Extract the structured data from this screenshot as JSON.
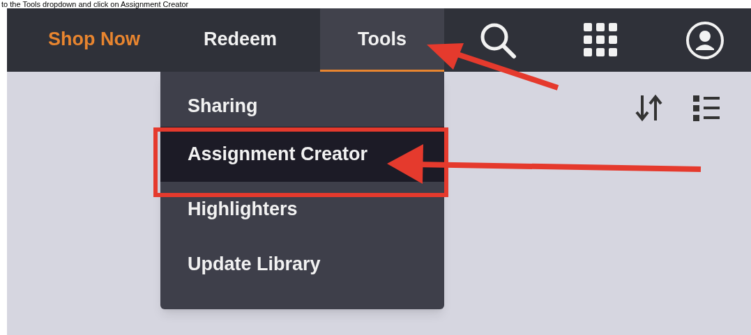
{
  "caption": "to the Tools dropdown and click on Assignment Creator",
  "nav": [
    {
      "label": "Shop Now",
      "kind": "promo",
      "selected": false
    },
    {
      "label": "Redeem",
      "kind": "link",
      "selected": false
    },
    {
      "label": "Tools",
      "kind": "link",
      "selected": true
    }
  ],
  "tools_menu": [
    {
      "label": "Sharing",
      "selected": false
    },
    {
      "label": "Assignment Creator",
      "selected": true
    },
    {
      "label": "Highlighters",
      "selected": false
    },
    {
      "label": "Update Library",
      "selected": false
    }
  ]
}
